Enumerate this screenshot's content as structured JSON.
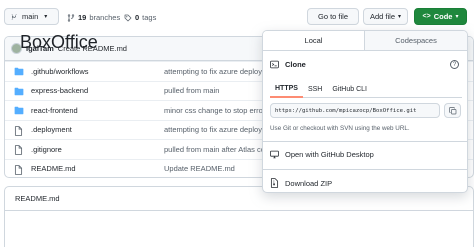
{
  "toolbar": {
    "branch": "main",
    "branches_count": "19",
    "branches_label": "branches",
    "tags_count": "0",
    "tags_label": "tags",
    "goto_file": "Go to file",
    "add_file": "Add file",
    "code": "Code"
  },
  "latest_commit": {
    "user": "IgalTam",
    "message": "Create README.md"
  },
  "files": [
    {
      "name": ".github/workflows",
      "type": "folder",
      "message": "attempting to fix azure deploy"
    },
    {
      "name": "express-backend",
      "type": "folder",
      "message": "pulled from main"
    },
    {
      "name": "react-frontend",
      "type": "folder",
      "message": "minor css change to stop error"
    },
    {
      "name": ".deployment",
      "type": "file",
      "message": "attempting to fix azure deploy"
    },
    {
      "name": ".gitignore",
      "type": "file",
      "message": "pulled from main after Atlas cor"
    },
    {
      "name": "README.md",
      "type": "file",
      "message": "Update README.md"
    }
  ],
  "readme": {
    "header": "README.md",
    "title": "BoxOffice"
  },
  "clone_panel": {
    "tab_local": "Local",
    "tab_codespaces": "Codespaces",
    "clone_label": "Clone",
    "help": "?",
    "subtabs": [
      "HTTPS",
      "SSH",
      "GitHub CLI"
    ],
    "url": "https://github.com/mpicazocp/BoxOffice.git",
    "hint": "Use Git or checkout with SVN using the web URL.",
    "open_desktop": "Open with GitHub Desktop",
    "download_zip": "Download ZIP"
  },
  "colors": {
    "accent_green": "#1f883d",
    "folder_blue": "#54aeff",
    "tab_underline": "#fd8c73"
  }
}
